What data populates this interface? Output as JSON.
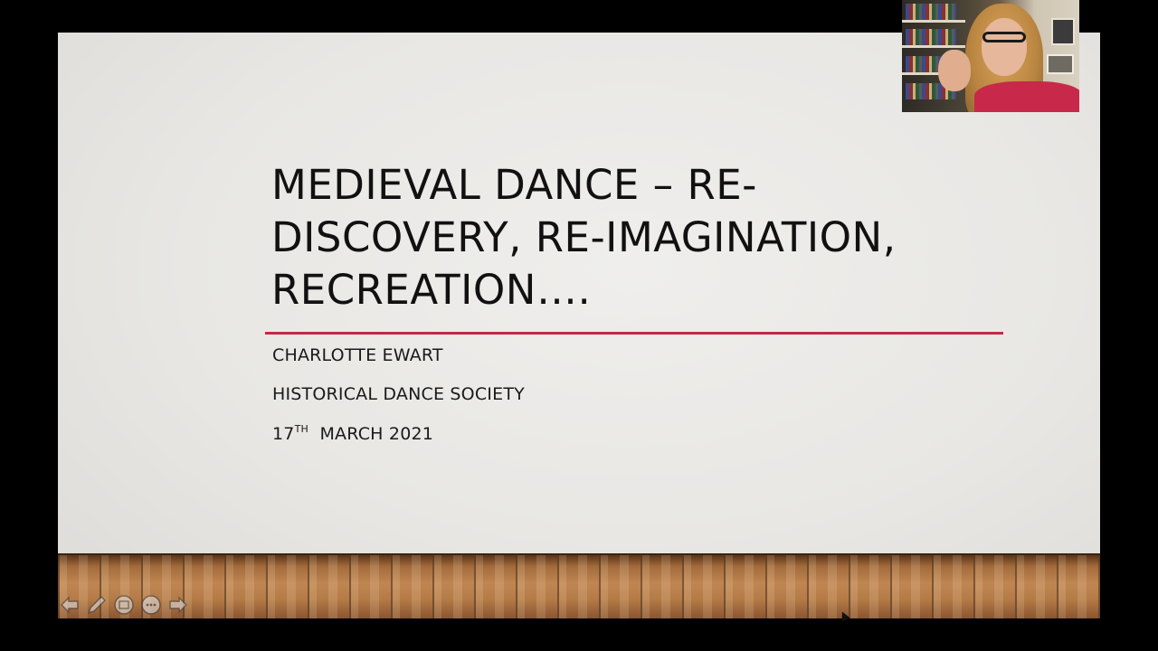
{
  "slide": {
    "title": "MEDIEVAL DANCE – RE-DISCOVERY, RE-IMAGINATION, RECREATION….",
    "title_lines": [
      "MEDIEVAL DANCE – RE-",
      "DISCOVERY, RE-IMAGINATION,",
      "RECREATION…."
    ],
    "presenter": "CHARLOTTE EWART",
    "organization": "HISTORICAL DANCE SOCIETY",
    "date_day": "17",
    "date_suffix": "TH",
    "date_rest": "MARCH 2021"
  },
  "colors": {
    "accent_rule": "#c22a45",
    "slide_background": "#e8e7e4",
    "letterbox": "#000000"
  },
  "controls": {
    "icons": [
      "previous-slide-icon",
      "pen-icon",
      "slide-overview-icon",
      "more-options-icon",
      "next-slide-icon"
    ]
  }
}
